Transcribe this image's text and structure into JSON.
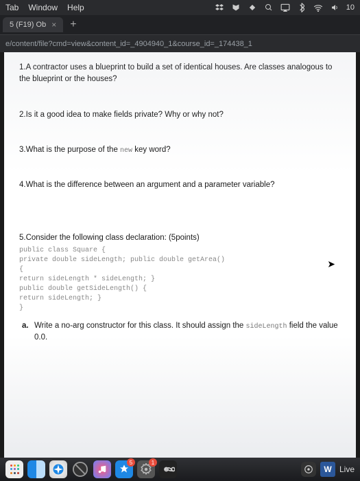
{
  "menubar": {
    "items": [
      "Tab",
      "Window",
      "Help"
    ],
    "time_fragment": "10"
  },
  "browser": {
    "tab_title": "5 (F19) Ob",
    "url": "e/content/file?cmd=view&content_id=_4904940_1&course_id=_174438_1"
  },
  "doc": {
    "q1": "1.A contractor uses a blueprint to build a set of identical houses. Are classes analogous to the blueprint or the houses?",
    "q2": "2.Is it a good idea to make fields private? Why or why not?",
    "q3_pre": "3.What is the purpose of the ",
    "q3_kw": "new",
    "q3_post": " key word?",
    "q4": "4.What is the difference between an argument and a parameter variable?",
    "q5_lead": "5.Consider the following class declaration: (5points)",
    "q5_code": "public class Square {\nprivate double sideLength; public double getArea()\n{\nreturn sideLength * sideLength; }\npublic double getSideLength() {\nreturn sideLength; }\n}",
    "q5a_pre": "Write a no-arg constructor for this class. It should assign the ",
    "q5a_kw": "sideLength",
    "q5a_post": " field the value 0.0.",
    "q5a_letter": "a."
  },
  "dock": {
    "badge1": "5",
    "badge2": "1",
    "word_label": "W",
    "live_label": "Live"
  }
}
